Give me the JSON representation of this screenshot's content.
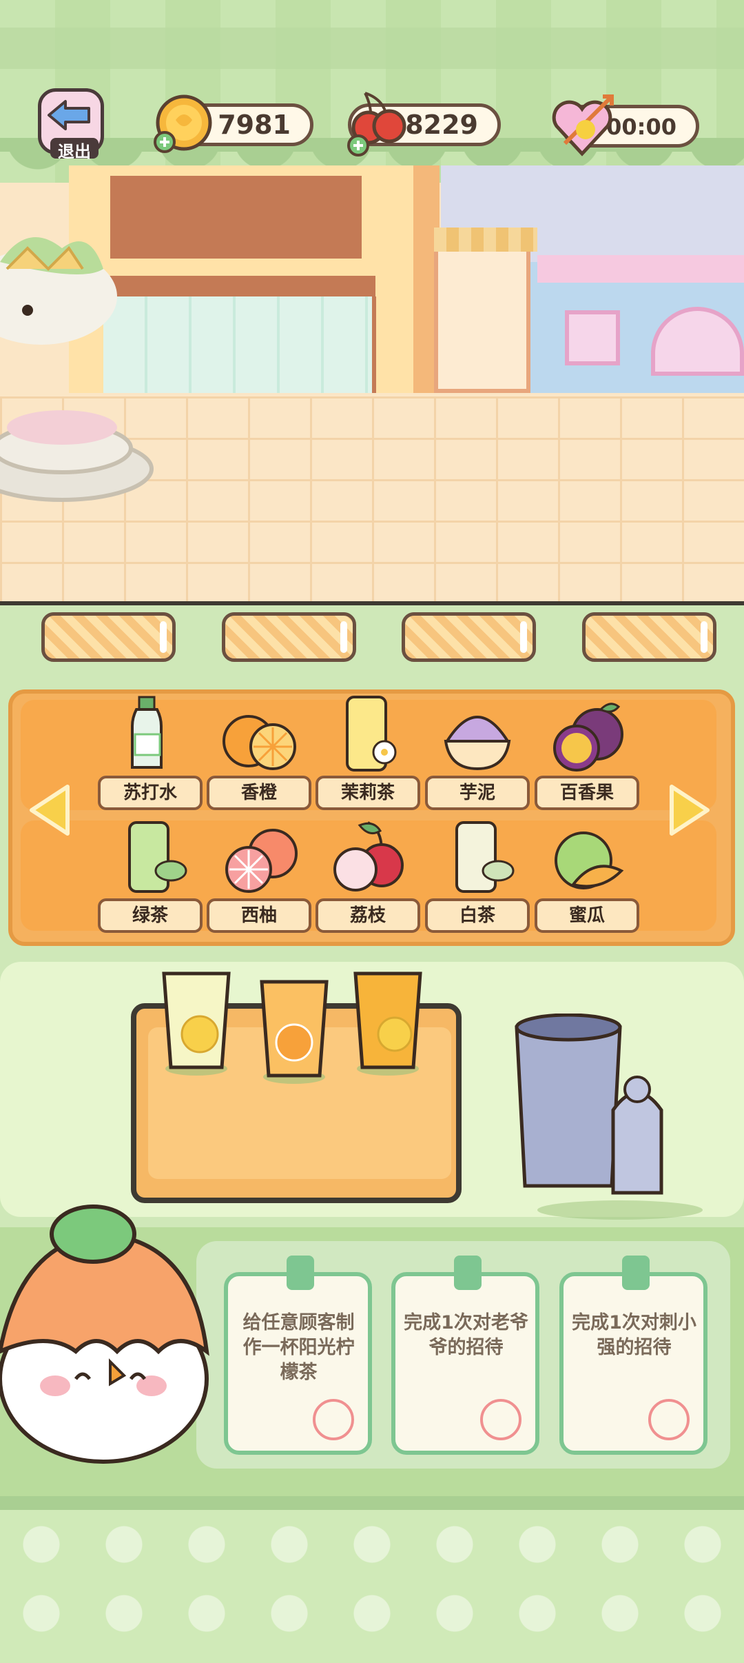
{
  "hud": {
    "exit_label": "退出",
    "coins": "7981",
    "cherries": "8229",
    "timer": "00:00",
    "icons": [
      "back-arrow-icon",
      "coin-icon",
      "cherry-icon",
      "heart-arrow-icon"
    ]
  },
  "ingredients": {
    "row1": [
      {
        "name": "苏打水",
        "icon": "soda-bottle-icon"
      },
      {
        "name": "香橙",
        "icon": "orange-icon"
      },
      {
        "name": "茉莉茶",
        "icon": "jasmine-tea-icon"
      },
      {
        "name": "芋泥",
        "icon": "taro-paste-icon"
      },
      {
        "name": "百香果",
        "icon": "passion-fruit-icon"
      }
    ],
    "row2": [
      {
        "name": "绿茶",
        "icon": "green-tea-icon"
      },
      {
        "name": "西柚",
        "icon": "grapefruit-icon"
      },
      {
        "name": "荔枝",
        "icon": "lychee-icon"
      },
      {
        "name": "白茶",
        "icon": "white-tea-icon"
      },
      {
        "name": "蜜瓜",
        "icon": "melon-icon"
      }
    ]
  },
  "tasks": [
    {
      "text": "给任意顾客制作一杯阳光柠檬茶"
    },
    {
      "text": "完成1次对老爷爷的招待"
    },
    {
      "text": "完成1次对刺小强的招待"
    }
  ],
  "colors": {
    "accent": "#f5b15e",
    "panel_border": "#e59a43",
    "task_border": "#7ec691",
    "check": "#f09090"
  }
}
